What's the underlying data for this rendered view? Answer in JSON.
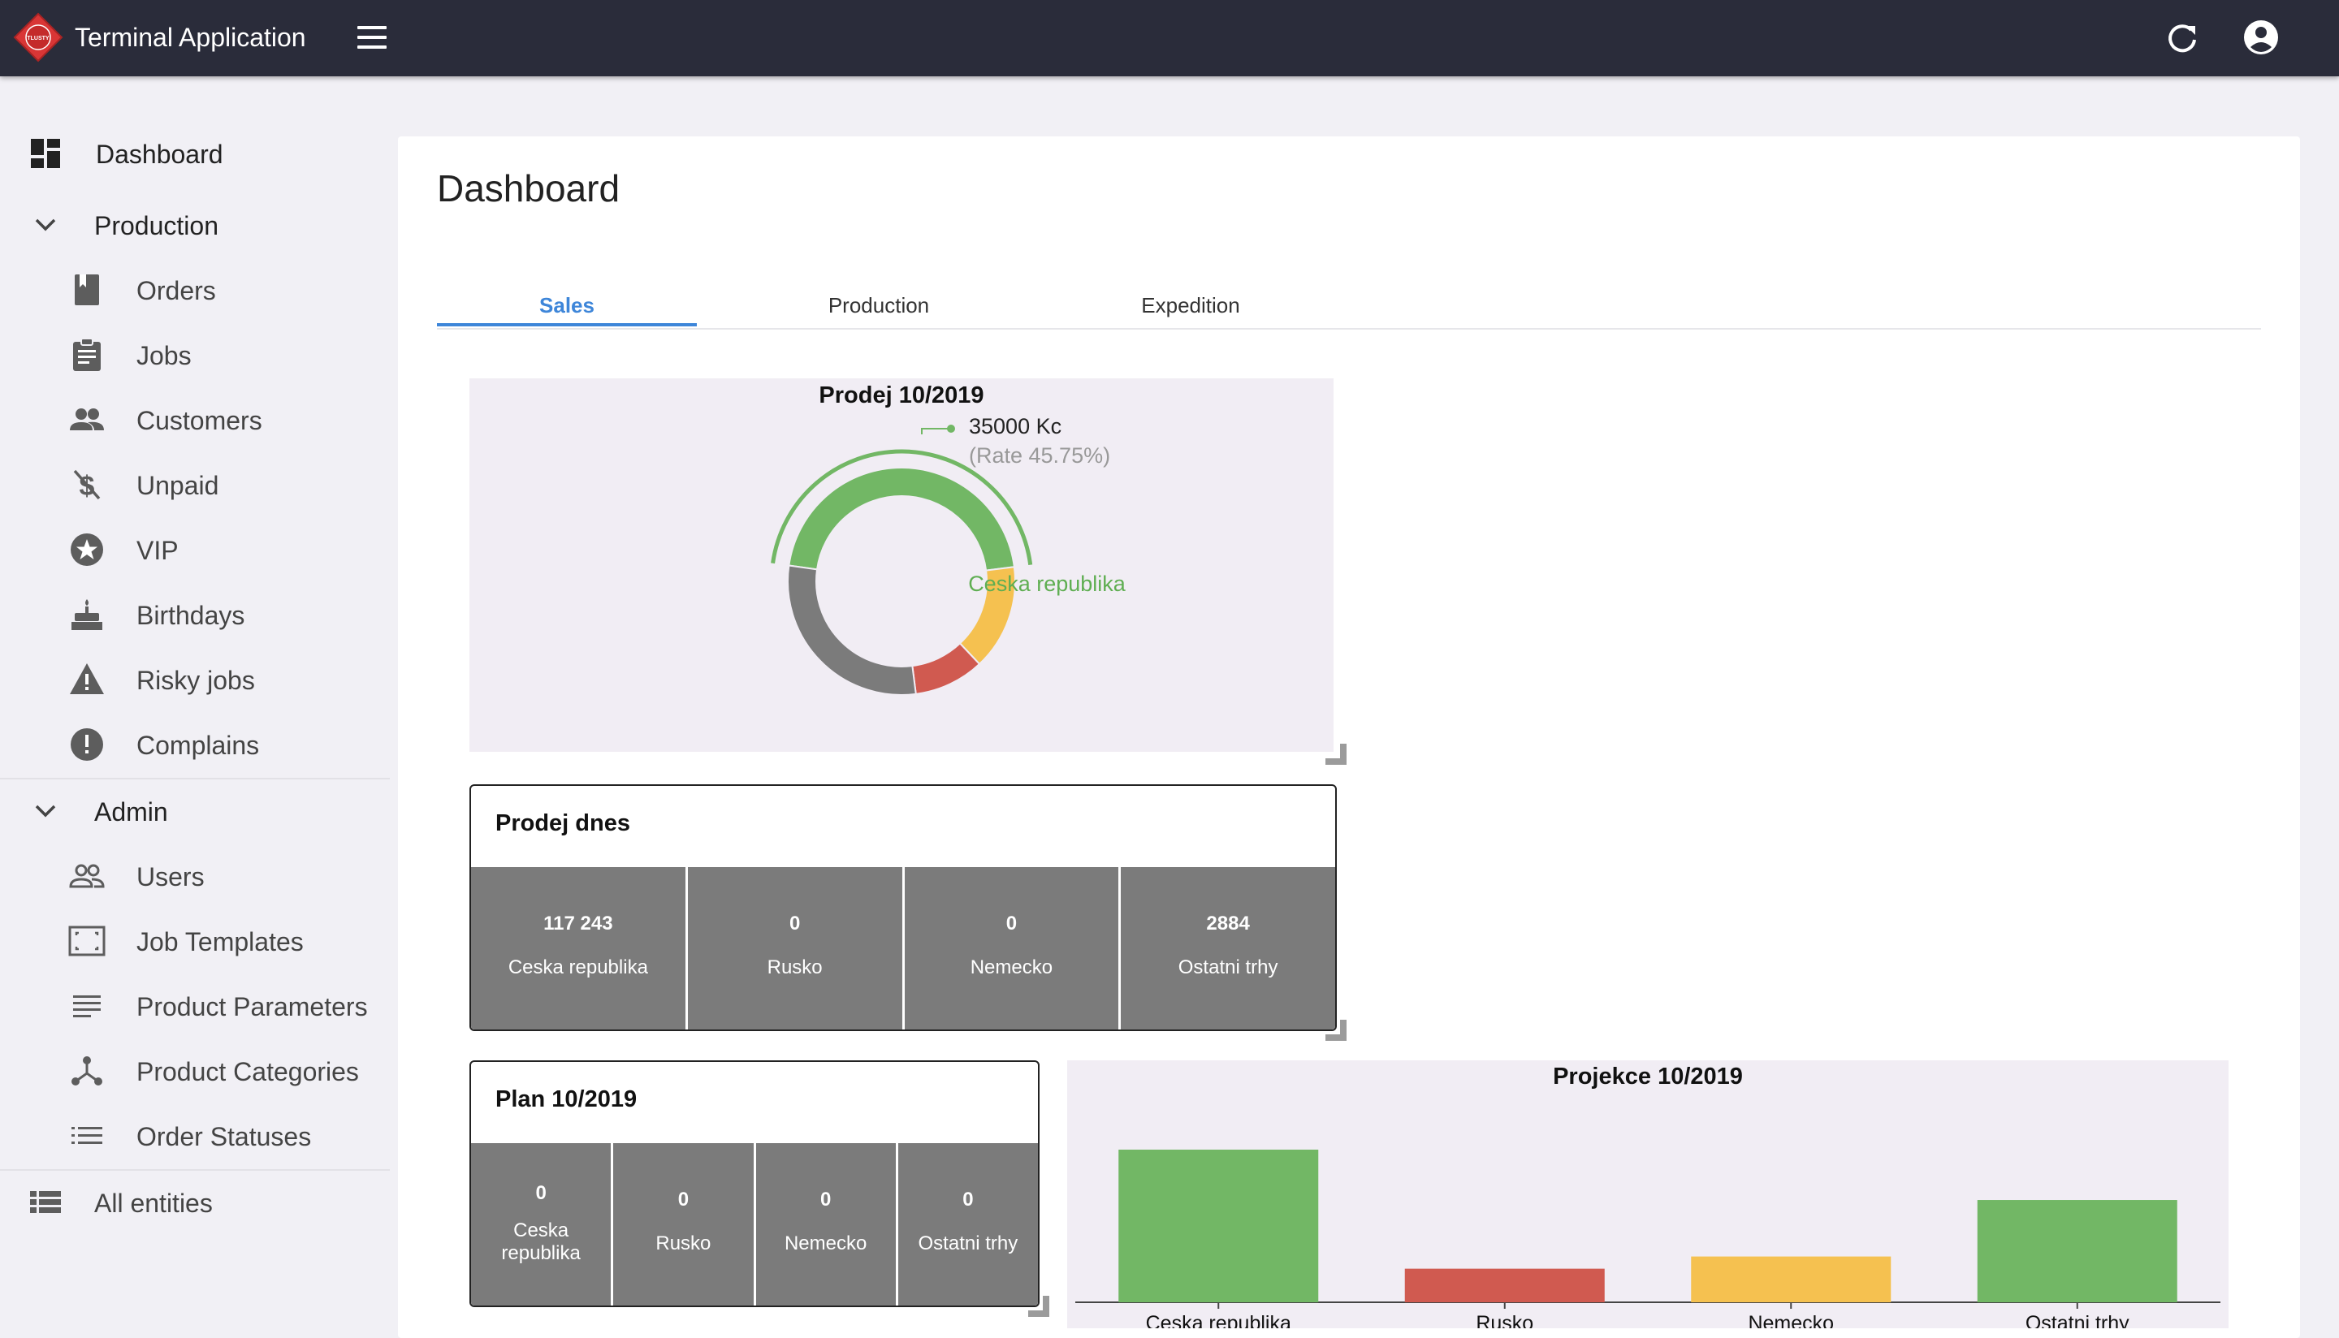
{
  "header": {
    "title": "Terminal Application",
    "logo_text": "TLUSTY",
    "icons": [
      "menu-icon",
      "refresh-icon",
      "account-circle-icon"
    ]
  },
  "sidebar": {
    "dashboard": "Dashboard",
    "production_group": "Production",
    "production_items": [
      {
        "label": "Orders",
        "icon": "book-icon"
      },
      {
        "label": "Jobs",
        "icon": "clipboard-icon"
      },
      {
        "label": "Customers",
        "icon": "people-icon"
      },
      {
        "label": "Unpaid",
        "icon": "money-off-icon"
      },
      {
        "label": "VIP",
        "icon": "star-circle-icon"
      },
      {
        "label": "Birthdays",
        "icon": "cake-icon"
      },
      {
        "label": "Risky jobs",
        "icon": "warning-icon"
      },
      {
        "label": "Complains",
        "icon": "error-icon"
      }
    ],
    "admin_group": "Admin",
    "admin_items": [
      {
        "label": "Users",
        "icon": "people-outline-icon"
      },
      {
        "label": "Job Templates",
        "icon": "template-icon"
      },
      {
        "label": "Product Parameters",
        "icon": "lines-icon"
      },
      {
        "label": "Product Categories",
        "icon": "tree-icon"
      },
      {
        "label": "Order Statuses",
        "icon": "list-icon"
      }
    ],
    "all_entities": "All entities"
  },
  "main": {
    "title": "Dashboard",
    "tabs": [
      "Sales",
      "Production",
      "Expedition"
    ],
    "active_tab": "Sales"
  },
  "donut": {
    "title": "Prodej 10/2019",
    "center_label": "Ceska republika",
    "callout_value": "35000 Kc",
    "callout_rate": "(Rate 45.75%)"
  },
  "prodej_dnes": {
    "title": "Prodej dnes",
    "cells": [
      {
        "value": "117 243",
        "label": "Ceska republika"
      },
      {
        "value": "0",
        "label": "Rusko"
      },
      {
        "value": "0",
        "label": "Nemecko"
      },
      {
        "value": "2884",
        "label": "Ostatni trhy"
      }
    ]
  },
  "plan": {
    "title": "Plan 10/2019",
    "cells": [
      {
        "value": "0",
        "label": "Ceska republika"
      },
      {
        "value": "0",
        "label": "Rusko"
      },
      {
        "value": "0",
        "label": "Nemecko"
      },
      {
        "value": "0",
        "label": "Ostatni trhy"
      }
    ]
  },
  "colors": {
    "green": "#72b765",
    "red": "#d05a50",
    "yellow": "#f5c150",
    "gray": "#7b7b7b",
    "accent": "#3e86d9",
    "topbar": "#2a2c3a"
  },
  "chart_data": [
    {
      "type": "pie",
      "title": "Prodej 10/2019",
      "categories": [
        "Ceska republika",
        "Nemecko",
        "Rusko",
        "Ostatni trhy"
      ],
      "values": [
        45.75,
        15,
        10,
        29.25
      ],
      "colors": [
        "#72b765",
        "#f5c150",
        "#d05a50",
        "#7b7b7b"
      ],
      "highlighted": "Ceska republika"
    },
    {
      "type": "bar",
      "title": "Projekce 10/2019",
      "categories": [
        "Ceska republika",
        "Rusko",
        "Nemecko",
        "Ostatni trhy"
      ],
      "values": [
        100,
        22,
        30,
        67
      ],
      "colors": [
        "#72b765",
        "#d05a50",
        "#f5c150",
        "#72b765"
      ],
      "ylim": [
        0,
        100
      ]
    }
  ]
}
